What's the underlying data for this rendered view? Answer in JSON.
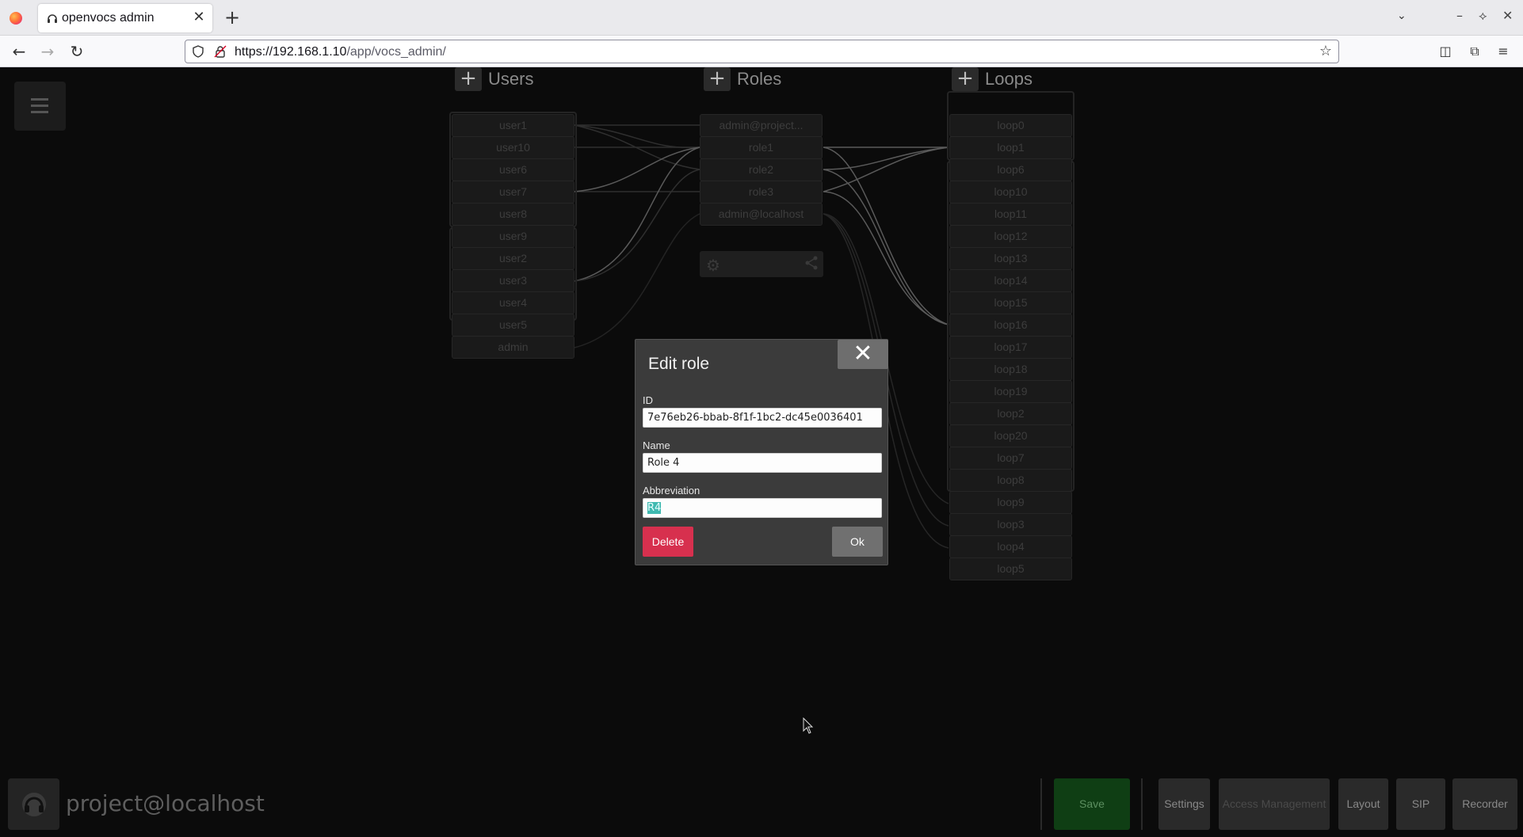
{
  "browser": {
    "tab_title": "openvocs admin",
    "url_host": "https://192.168.1.10",
    "url_path": "/app/vocs_admin/"
  },
  "columns": {
    "users": {
      "title": "Users",
      "items": [
        "user1",
        "user10",
        "user6",
        "user7",
        "user8",
        "user9",
        "user2",
        "user3",
        "user4",
        "user5",
        "admin"
      ]
    },
    "roles": {
      "title": "Roles",
      "items": [
        "admin@project...",
        "role1",
        "role2",
        "role3",
        "admin@localhost"
      ]
    },
    "loops": {
      "title": "Loops",
      "items": [
        "loop0",
        "loop1",
        "loop6",
        "loop10",
        "loop11",
        "loop12",
        "loop13",
        "loop14",
        "loop15",
        "loop16",
        "loop17",
        "loop18",
        "loop19",
        "loop2",
        "loop20",
        "loop7",
        "loop8",
        "loop9",
        "loop3",
        "loop4",
        "loop5"
      ]
    }
  },
  "dialog": {
    "title": "Edit role",
    "id_label": "ID",
    "id_value": "7e76eb26-bbab-8f1f-1bc2-dc45e0036401",
    "name_label": "Name",
    "name_value": "Role 4",
    "abbr_label": "Abbreviation",
    "abbr_value": "R4",
    "delete_label": "Delete",
    "ok_label": "Ok"
  },
  "footer": {
    "project": "project@localhost",
    "buttons": {
      "save": "Save",
      "settings": "Settings",
      "access_management": "Access Management",
      "layout": "Layout",
      "sip": "SIP",
      "recorder": "Recorder"
    }
  },
  "colors": {
    "save_bg": "#0f3e14",
    "delete_bg": "#d7304e",
    "selection": "#3fb9b0"
  }
}
